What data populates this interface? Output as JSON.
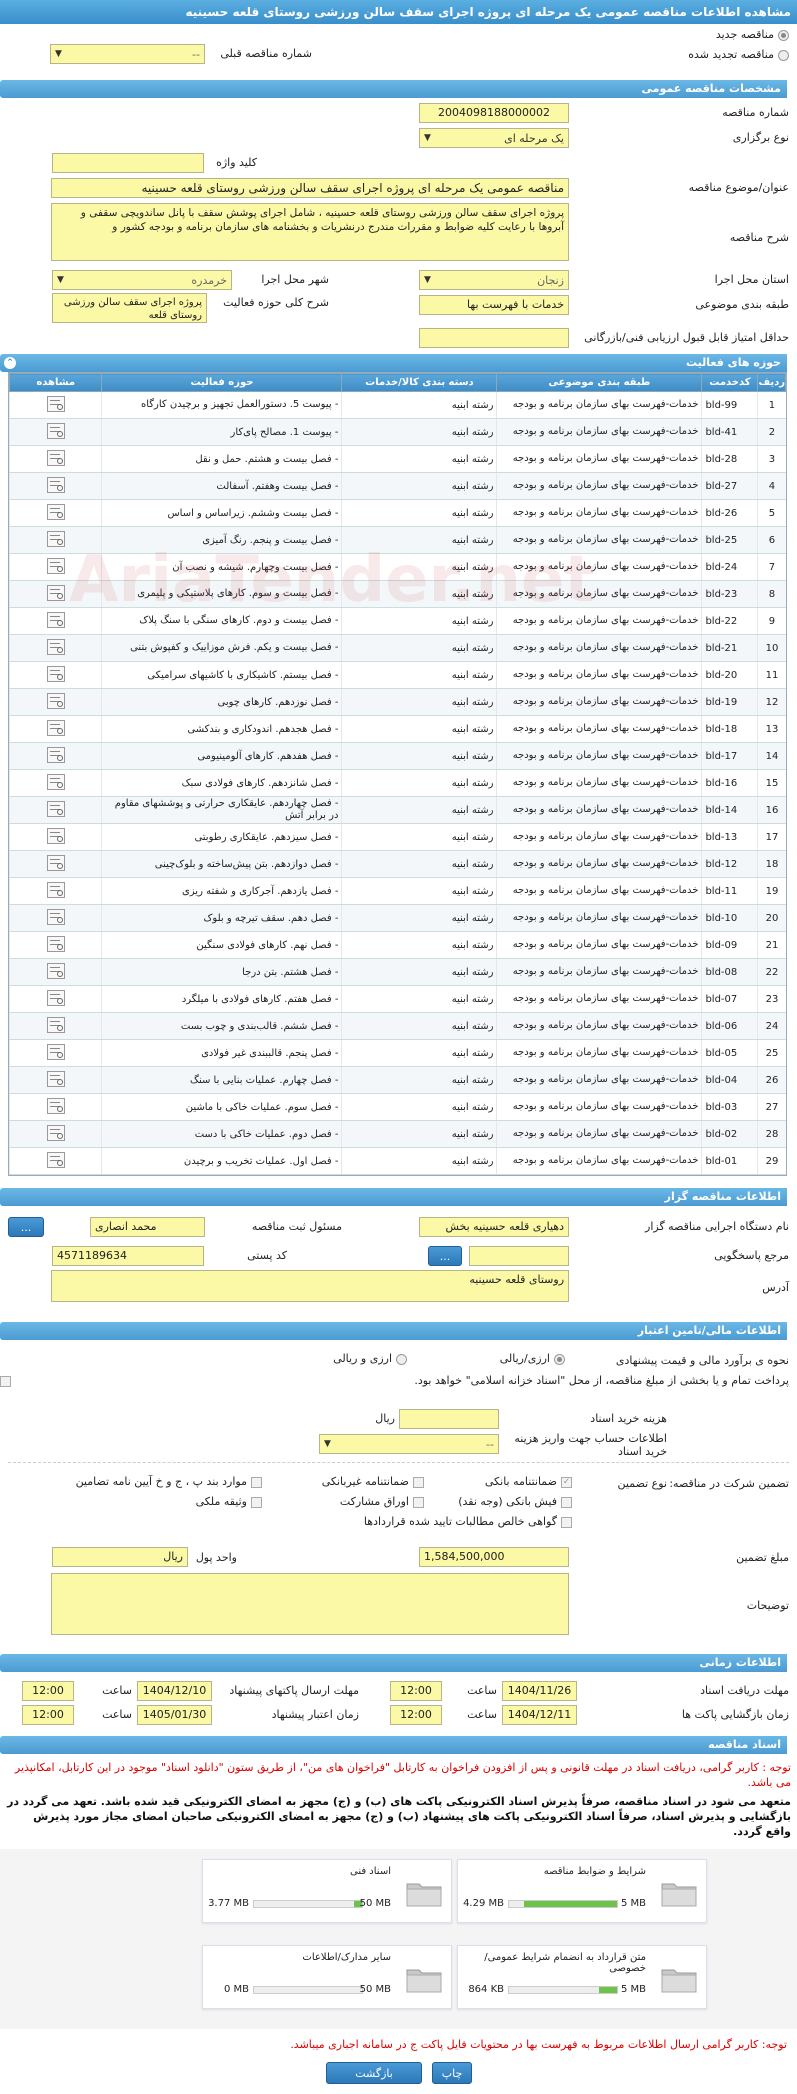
{
  "page_title": "مشاهده اطلاعات مناقصه عمومی یک مرحله ای پروژه اجرای سقف سالن ورزشی روستای قلعه حسینیه",
  "top": {
    "radio_new": "مناقصه جدید",
    "radio_renew": "مناقصه تجدید شده",
    "prev_tender_label": "شماره مناقصه قبلی",
    "prev_tender_value": "--"
  },
  "general": {
    "section": "مشخصات مناقصه عمومی",
    "tender_number_label": "شماره مناقصه",
    "tender_number": "2004098188000002",
    "hold_type_label": "نوع برگزاری",
    "hold_type": "یک مرحله ای",
    "keyword_label": "کلید واژه",
    "subject_label": "عنوان/موضوع مناقصه",
    "subject": "مناقصه عمومی یک مرحله ای پروژه اجرای سقف سالن ورزشی روستای قلعه حسینیه",
    "desc_label": "شرح مناقصه",
    "desc": "پروژه اجرای سقف سالن ورزشی روستای قلعه حسینیه ، شامل اجرای پوشش سقف با پانل ساندویچی سقفی و آبروها با رعایت کلیه ضوابط و مقررات مندرج درنشریات و بخشنامه های سازمان برنامه و بودجه کشور و",
    "province_label": "استان محل اجرا",
    "province": "زنجان",
    "city_label": "شهر محل اجرا",
    "city": "خرمدره",
    "category_label": "طبقه بندی موضوعی",
    "category": "خدمات با فهرست بها",
    "activity_label": "شرح کلی حوزه فعالیت",
    "activity": "پروژه اجرای سقف سالن ورزشی روستای قلعه",
    "min_score_label": "حداقل امتیاز قابل قبول ارزیابی فنی/بازرگانی"
  },
  "activities": {
    "section": "حوزه های فعالیت",
    "headers": [
      "ردیف",
      "کدخدمت",
      "طبقه بندی موضوعی",
      "دسته بندی کالا/خدمات",
      "حوزه فعالیت",
      "مشاهده"
    ],
    "category_text": "خدمات-فهرست بهای سازمان برنامه و بودجه",
    "group_text": "رشته ابنیه",
    "rows": [
      {
        "n": "1",
        "code": "bld-99",
        "area": "- پیوست 5. دستورالعمل تجهیز و برچیدن کارگاه"
      },
      {
        "n": "2",
        "code": "bld-41",
        "area": "- پیوست 1. مصالح پای‌کار"
      },
      {
        "n": "3",
        "code": "bld-28",
        "area": "- فصل بیست و هشتم. حمل و نقل"
      },
      {
        "n": "4",
        "code": "bld-27",
        "area": "- فصل بیست وهفتم. آسفالت"
      },
      {
        "n": "5",
        "code": "bld-26",
        "area": "- فصل بیست وششم. زیراساس و اساس"
      },
      {
        "n": "6",
        "code": "bld-25",
        "area": "- فصل بیست و پنجم. رنگ آمیزی"
      },
      {
        "n": "7",
        "code": "bld-24",
        "area": "- فصل بیست وچهارم. شیشه و نصب آن"
      },
      {
        "n": "8",
        "code": "bld-23",
        "area": "- فصل بیست و سوم. کارهای پلاستیکی و پلیمری"
      },
      {
        "n": "9",
        "code": "bld-22",
        "area": "- فصل بیست و دوم. کارهای سنگی با سنگ پلاک"
      },
      {
        "n": "10",
        "code": "bld-21",
        "area": "- فصل بیست و یکم. فرش موزاییک و کفپوش بتنی"
      },
      {
        "n": "11",
        "code": "bld-20",
        "area": "- فصل بیستم. کاشیکاری با کاشیهای سرامیکی"
      },
      {
        "n": "12",
        "code": "bld-19",
        "area": "- فصل نوزدهم. کارهای چوبی"
      },
      {
        "n": "13",
        "code": "bld-18",
        "area": "- فصل هجدهم. اندودکاری و بندکشی"
      },
      {
        "n": "14",
        "code": "bld-17",
        "area": "- فصل هفدهم. کارهای آلومینیومی"
      },
      {
        "n": "15",
        "code": "bld-16",
        "area": "- فصل شانزدهم. کارهای فولادی سبک"
      },
      {
        "n": "16",
        "code": "bld-14",
        "area": "- فصل چهاردهم. عایقکاری حرارتی و پوششهای مقاوم در برابر آتش"
      },
      {
        "n": "17",
        "code": "bld-13",
        "area": "- فصل سیزدهم. عایقکاری رطوبتی"
      },
      {
        "n": "18",
        "code": "bld-12",
        "area": "- فصل دوازدهم. بتن پیش‌ساخته و بلوک‌چینی"
      },
      {
        "n": "19",
        "code": "bld-11",
        "area": "- فصل یازدهم. آجرکاری و شفته ریزی"
      },
      {
        "n": "20",
        "code": "bld-10",
        "area": "- فصل دهم. سقف تیرچه و بلوک"
      },
      {
        "n": "21",
        "code": "bld-09",
        "area": "- فصل نهم. کارهای فولادی سنگین"
      },
      {
        "n": "22",
        "code": "bld-08",
        "area": "- فصل هشتم. بتن درجا"
      },
      {
        "n": "23",
        "code": "bld-07",
        "area": "- فصل هفتم. کارهای فولادی با میلگرد"
      },
      {
        "n": "24",
        "code": "bld-06",
        "area": "- فصل ششم. قالب‌بندی و چوب بست"
      },
      {
        "n": "25",
        "code": "bld-05",
        "area": "- فصل پنجم. قالببندی غیر فولادی"
      },
      {
        "n": "26",
        "code": "bld-04",
        "area": "- فصل چهارم. عملیات بنایی با سنگ"
      },
      {
        "n": "27",
        "code": "bld-03",
        "area": "- فصل سوم. عملیات خاکی با ماشین"
      },
      {
        "n": "28",
        "code": "bld-02",
        "area": "- فصل دوم. عملیات خاکی با دست"
      },
      {
        "n": "29",
        "code": "bld-01",
        "area": "- فصل اول. عملیات تخریب و برچیدن"
      }
    ]
  },
  "organizer": {
    "section": "اطلاعات مناقصه گزار",
    "org_label": "نام دستگاه اجرایی مناقصه گزار",
    "org": "دهیاری قلعه حسینیه بخش",
    "responsible_label": "مسئول ثبت مناقصه",
    "responsible": "محمد انصاری",
    "ref_label": "مرجع پاسخگویی",
    "postal_label": "کد پستی",
    "postal": "4571189634",
    "address_label": "آدرس",
    "address": "روستای قلعه حسینیه",
    "dots": "..."
  },
  "finance": {
    "section": "اطلاعات مالی/تامین اعتبار",
    "estimate_label": "نحوه ی برآورد مالی و قیمت پیشنهادی",
    "opt_rial": "ارزی/ریالی",
    "opt_fx": "ارزی و ریالی",
    "islamic_label": "پرداخت تمام و یا بخشی از مبلغ مناقصه، از محل \"اسناد خزانه اسلامی\" خواهد بود.",
    "doc_cost_label": "هزینه خرید اسناد",
    "doc_cost_unit": "ریال",
    "account_label": "اطلاعات حساب جهت واریز هزینه خرید اسناد",
    "account_value": "--",
    "guarantee_label": "تضمین شرکت در مناقصه:",
    "guarantee_type_label": "نوع تضمین",
    "g1": "ضمانتنامه بانکی",
    "g2": "ضمانتنامه غیربانکی",
    "g3": "موارد بند پ ، ج و خ آیین نامه تضامین",
    "g4": "فیش بانکی (وجه نقد)",
    "g5": "اوراق مشارکت",
    "g6": "وثیقه ملکی",
    "g7": "گواهی خالص مطالبات تایید شده قراردادها",
    "amount_label": "مبلغ تضمین",
    "amount": "1,584,500,000",
    "currency_label": "واحد پول",
    "currency": "ریال",
    "notes_label": "توضیحات"
  },
  "timing": {
    "section": "اطلاعات زمانی",
    "receive_label": "مهلت دریافت اسناد",
    "receive_date": "1404/11/26",
    "receive_time": "12:00",
    "send_label": "مهلت ارسال پاکتهای پیشنهاد",
    "send_date": "1404/12/10",
    "send_time": "12:00",
    "open_label": "زمان بازگشایی پاکت ها",
    "open_date": "1404/12/11",
    "open_time": "12:00",
    "valid_label": "زمان اعتبار پیشنهاد",
    "valid_date": "1405/01/30",
    "valid_time": "12:00",
    "time_label": "ساعت"
  },
  "documents": {
    "section": "اسناد مناقصه",
    "note1": "توجه : کاربر گرامی، دریافت اسناد در مهلت قانونی و پس از افزودن فراخوان به کارتابل \"فراخوان های من\"، از طریق ستون \"دانلود اسناد\" موجود در این کارتابل، امکانپذیر می باشد.",
    "note2": "متعهد می شود در اسناد مناقصه، صرفاً پذیرش اسناد الکترونیکی پاکت های (ب) و (ج) مجهز به امضای الکترونیکی قید شده باشد. تعهد می گردد در بازگشایی و پذیرش اسناد، صرفاً اسناد الکترونیکی پاکت های پیشنهاد (ب) و (ج) مجهز به امضای الکترونیکی صاحبان امضای مجاز مورد پذیرش واقع گردد.",
    "cards": [
      {
        "title": "شرایط و ضوابط مناقصه",
        "used": "4.29 MB",
        "max": "5 MB",
        "fill": 0.86
      },
      {
        "title": "اسناد فنی",
        "used": "3.77 MB",
        "max": "50 MB",
        "fill": 0.075
      },
      {
        "title": "متن قرارداد به انضمام شرایط عمومی/خصوصی",
        "used": "864 KB",
        "max": "5 MB",
        "fill": 0.17
      },
      {
        "title": "سایر مدارک/اطلاعات",
        "used": "0 MB",
        "max": "50 MB",
        "fill": 0
      }
    ],
    "note3": "توجه: کاربر گرامی ارسال اطلاعات مربوط به فهرست بها در محتویات فایل پاکت ج در سامانه اجباری میباشد."
  },
  "actions": {
    "print": "چاپ",
    "back": "بازگشت"
  },
  "watermark": "AriaTender.net"
}
